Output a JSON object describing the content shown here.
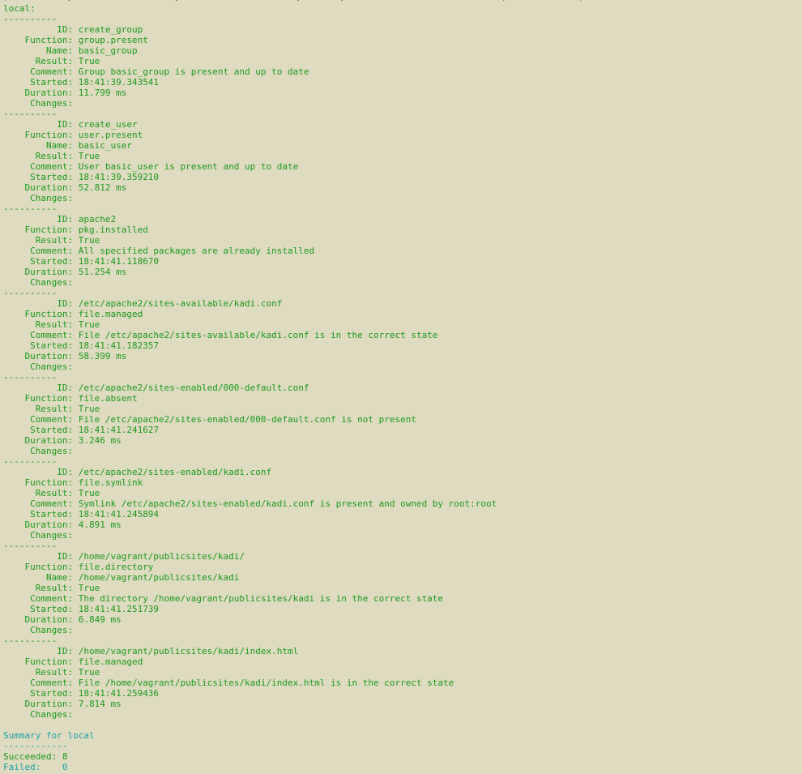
{
  "terminal": {
    "cut_top_line": "(            [                     [                        ]        ]                                (               )",
    "host": "local:",
    "separator": "----------",
    "labels": {
      "id": "          ID:",
      "function": "    Function:",
      "name": "        Name:",
      "result": "      Result:",
      "comment": "     Comment:",
      "started": "     Started:",
      "duration": "    Duration:",
      "changes": "     Changes:"
    },
    "states": [
      {
        "id": "create_group",
        "function": "group.present",
        "name": "basic_group",
        "result": "True",
        "comment": "Group basic_group is present and up to date",
        "started": "18:41:39.343541",
        "duration": "11.799 ms"
      },
      {
        "id": "create_user",
        "function": "user.present",
        "name": "basic_user",
        "result": "True",
        "comment": "User basic_user is present and up to date",
        "started": "18:41:39.359210",
        "duration": "52.812 ms"
      },
      {
        "id": "apache2",
        "function": "pkg.installed",
        "result": "True",
        "comment": "All specified packages are already installed",
        "started": "18:41:41.118670",
        "duration": "51.254 ms"
      },
      {
        "id": "/etc/apache2/sites-available/kadi.conf",
        "function": "file.managed",
        "result": "True",
        "comment": "File /etc/apache2/sites-available/kadi.conf is in the correct state",
        "started": "18:41:41.182357",
        "duration": "58.399 ms"
      },
      {
        "id": "/etc/apache2/sites-enabled/000-default.conf",
        "function": "file.absent",
        "result": "True",
        "comment": "File /etc/apache2/sites-enabled/000-default.conf is not present",
        "started": "18:41:41.241627",
        "duration": "3.246 ms"
      },
      {
        "id": "/etc/apache2/sites-enabled/kadi.conf",
        "function": "file.symlink",
        "result": "True",
        "comment": "Symlink /etc/apache2/sites-enabled/kadi.conf is present and owned by root:root",
        "started": "18:41:41.245894",
        "duration": "4.891 ms"
      },
      {
        "id": "/home/vagrant/publicsites/kadi/",
        "function": "file.directory",
        "name": "/home/vagrant/publicsites/kadi",
        "result": "True",
        "comment": "The directory /home/vagrant/publicsites/kadi is in the correct state",
        "started": "18:41:41.251739",
        "duration": "6.849 ms"
      },
      {
        "id": "/home/vagrant/publicsites/kadi/index.html",
        "function": "file.managed",
        "result": "True",
        "comment": "File /home/vagrant/publicsites/kadi/index.html is in the correct state",
        "started": "18:41:41.259436",
        "duration": "7.814 ms"
      }
    ],
    "summary": {
      "title": "Summary for local",
      "separator": "------------",
      "succeeded": "Succeeded: 8",
      "failed": "Failed:    0"
    },
    "colors": {
      "background": "#dedbc1",
      "ok_green": "#1b9a1b",
      "summary_cyan": "#19a3a3"
    }
  }
}
